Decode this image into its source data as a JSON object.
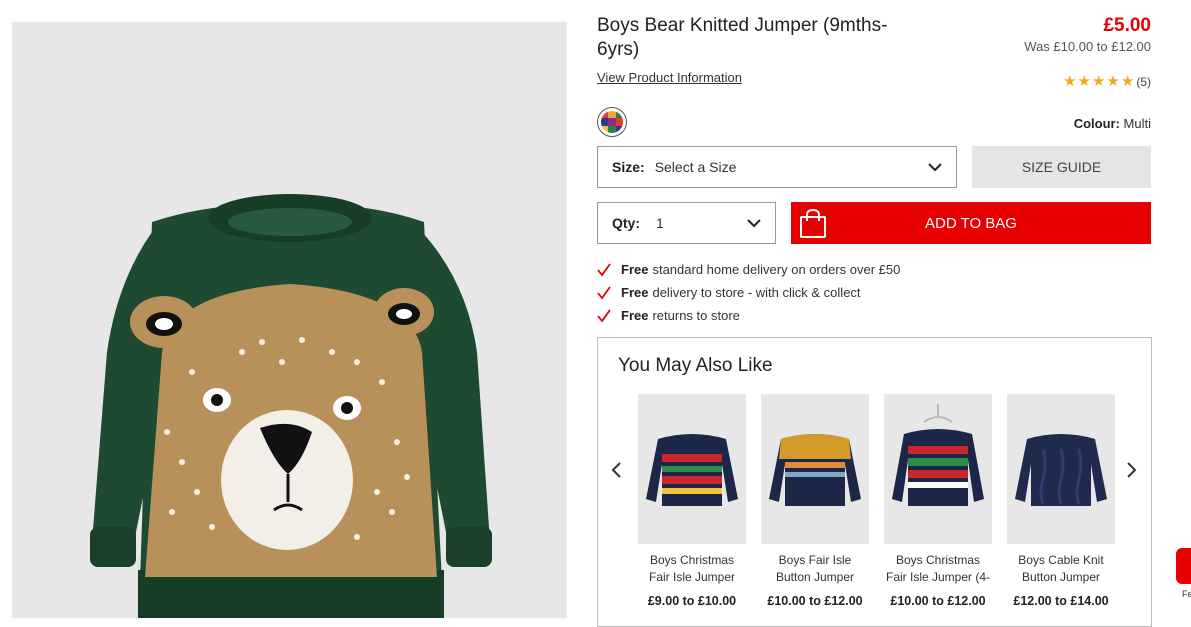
{
  "product": {
    "title": "Boys Bear Knitted Jumper (9mths-6yrs)",
    "view_info": "View Product Information",
    "price": "£5.00",
    "was_price": "Was £10.00 to £12.00",
    "rating": {
      "stars": 5,
      "count": "(5)"
    },
    "colour_label": "Colour:",
    "colour_value": "Multi",
    "accent_color": "#e60000",
    "star_color": "#f5a623"
  },
  "size": {
    "label": "Size:",
    "value": "Select a Size",
    "guide_label": "SIZE GUIDE"
  },
  "qty": {
    "label": "Qty:",
    "value": "1"
  },
  "add_to_bag": "ADD TO BAG",
  "benefits": [
    {
      "bold": "Free",
      "text": "standard home delivery on orders over £50"
    },
    {
      "bold": "Free",
      "text": "delivery to store - with click & collect"
    },
    {
      "bold": "Free",
      "text": "returns to store"
    }
  ],
  "recommendations": {
    "title": "You May Also Like",
    "items": [
      {
        "name": "Boys Christmas Fair Isle Jumper",
        "price": "£9.00 to £10.00",
        "image": "navy christmas fair isle jumper"
      },
      {
        "name": "Boys Fair Isle Button Jumper",
        "price": "£10.00 to £12.00",
        "image": "mustard fair isle button jumper"
      },
      {
        "name": "Boys Christmas Fair Isle Jumper (4-",
        "price": "£10.00 to £12.00",
        "image": "christmas fair isle jumper on hanger"
      },
      {
        "name": "Boys Cable Knit Button Jumper",
        "price": "£12.00 to £14.00",
        "image": "navy cable knit jumper"
      }
    ]
  },
  "side_tab_text": "Fe"
}
